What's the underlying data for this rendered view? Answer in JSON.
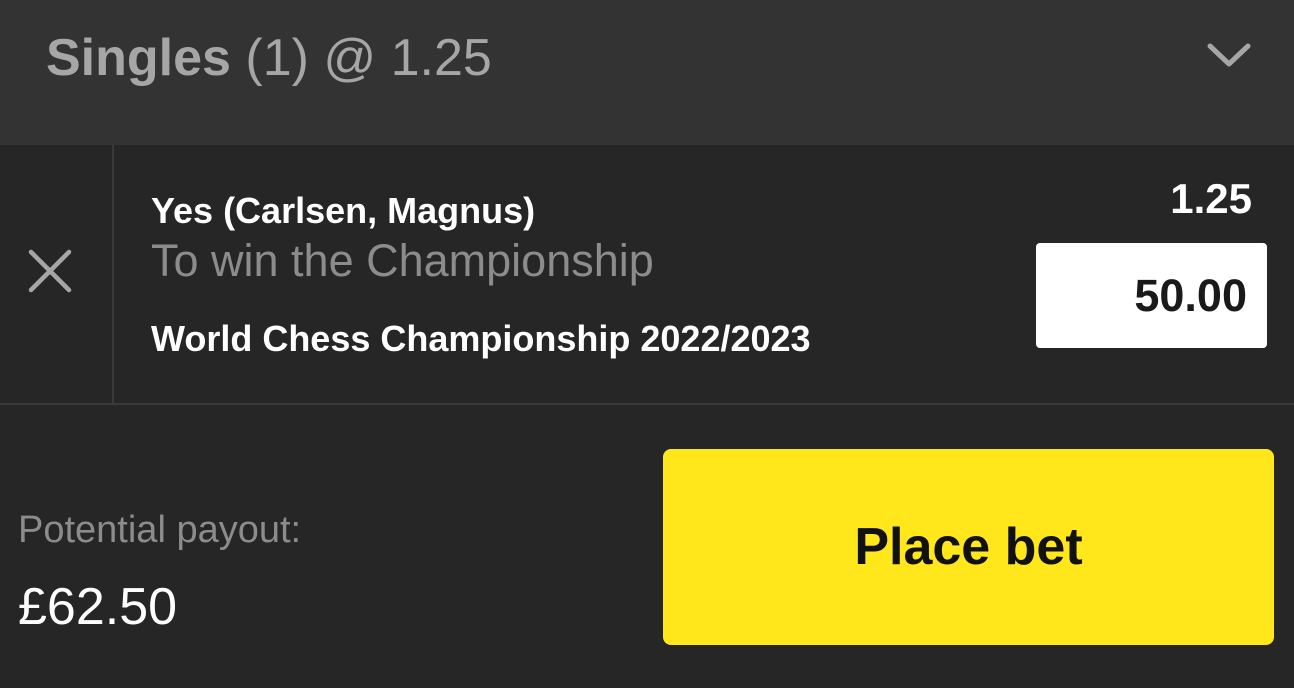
{
  "header": {
    "title_strong": "Singles",
    "title_rest": " (1) @ 1.25",
    "chevron_icon": "chevron-down-icon"
  },
  "bet": {
    "remove_icon": "close-icon",
    "selection": "Yes (Carlsen, Magnus)",
    "market": "To win the Championship",
    "event": "World Chess Championship 2022/2023",
    "odds": "1.25",
    "stake": "50.00"
  },
  "footer": {
    "payout_label": "Potential payout:",
    "payout_value": "£62.50",
    "place_bet_label": "Place bet"
  },
  "colors": {
    "accent": "#ffe71c",
    "header_bg": "#333333",
    "body_bg": "#262626",
    "muted_text": "#8c8c8c"
  }
}
